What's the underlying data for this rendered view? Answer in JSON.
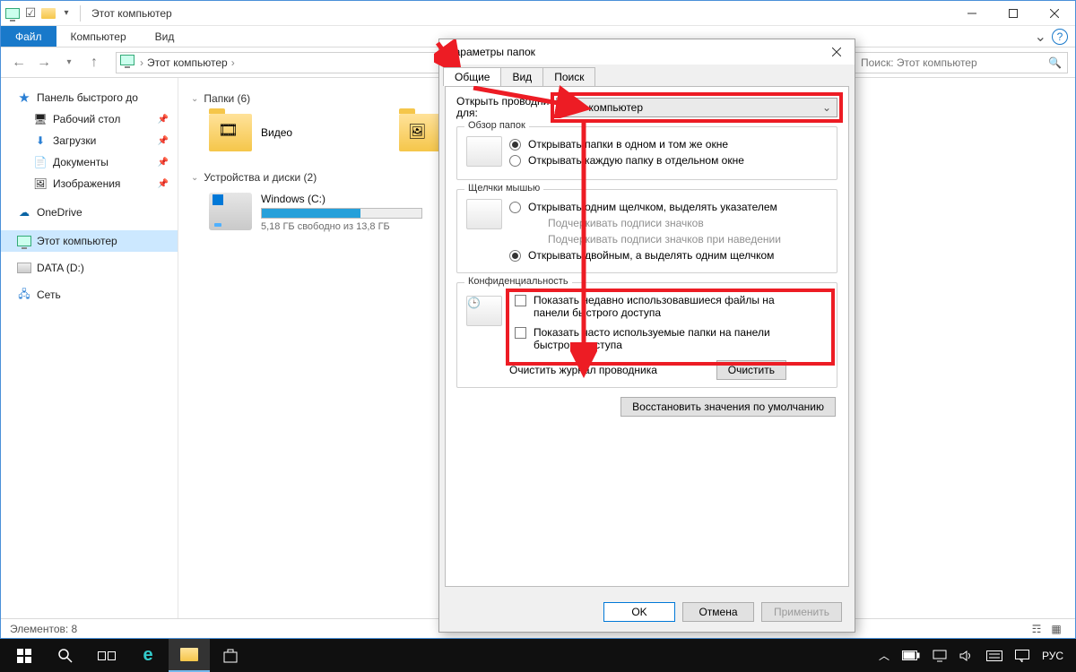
{
  "titlebar": {
    "title": "Этот компьютер"
  },
  "ribbon": {
    "file": "Файл",
    "computer": "Компьютер",
    "view": "Вид"
  },
  "address": {
    "root": "Этот компьютер"
  },
  "search": {
    "placeholder": "Поиск: Этот компьютер"
  },
  "sidebar": {
    "quick": "Панель быстрого до",
    "desktop": "Рабочий стол",
    "downloads": "Загрузки",
    "documents": "Документы",
    "pictures": "Изображения",
    "onedrive": "OneDrive",
    "thispc": "Этот компьютер",
    "data": "DATA (D:)",
    "network": "Сеть"
  },
  "main": {
    "folders_hdr": "Папки (6)",
    "video": "Видео",
    "pictures": "Изображения",
    "drives_hdr": "Устройства и диски (2)",
    "c_name": "Windows (C:)",
    "c_sub": "5,18 ГБ свободно из 13,8 ГБ"
  },
  "status": {
    "count": "Элементов: 8"
  },
  "dialog": {
    "title": "Параметры папок",
    "tab_general": "Общие",
    "tab_view": "Вид",
    "tab_search": "Поиск",
    "open_for": "Открыть проводник для:",
    "open_for_short": "Открыть проводни",
    "open_for_line2": "для:",
    "open_value": "Этот компьютер",
    "browse_legend": "Обзор папок",
    "browse_same": "Открывать папки в одном и том же окне",
    "browse_sep": "Открывать каждую папку в отдельном окне",
    "click_legend": "Щелчки мышью",
    "click_single": "Открывать одним щелчком, выделять указателем",
    "click_underline_browser": "Подчеркивать подписи значков",
    "click_underline_hover": "Подчеркивать подписи значков при наведении",
    "click_double": "Открывать двойным, а выделять одним щелчком",
    "priv_legend": "Конфиденциальность",
    "priv_recent": "Показать недавно использовавшиеся файлы на панели быстрого доступа",
    "priv_frequent": "Показать часто используемые папки на панели быстрого доступа",
    "clear_label": "Очистить журнал проводника",
    "clear_btn": "Очистить",
    "restore": "Восстановить значения по умолчанию",
    "ok": "OK",
    "cancel": "Отмена",
    "apply": "Применить"
  },
  "tray": {
    "lang": "РУС"
  }
}
